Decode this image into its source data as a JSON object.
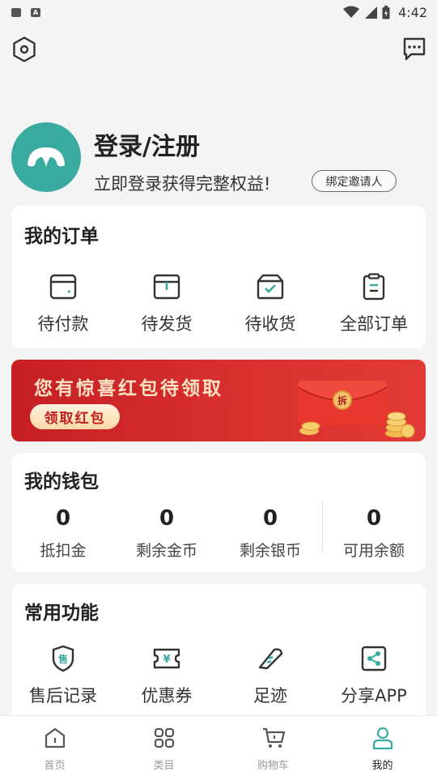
{
  "status_bar": {
    "time": "4:42"
  },
  "profile": {
    "title": "登录/注册",
    "subtitle": "立即登录获得完整权益!",
    "invite_label": "绑定邀请人"
  },
  "orders": {
    "title": "我的订单",
    "items": [
      {
        "label": "待付款",
        "icon": "wallet-card-icon"
      },
      {
        "label": "待发货",
        "icon": "box-icon"
      },
      {
        "label": "待收货",
        "icon": "delivery-check-icon"
      },
      {
        "label": "全部订单",
        "icon": "clipboard-icon"
      }
    ]
  },
  "banner": {
    "title": "您有惊喜红包待领取",
    "button_label": "领取红包",
    "envelope_char": "拆",
    "colors": {
      "bg": "#d12a2a",
      "text": "#fde3c4"
    }
  },
  "wallet": {
    "title": "我的钱包",
    "items": [
      {
        "value": "0",
        "label": "抵扣金"
      },
      {
        "value": "0",
        "label": "剩余金币"
      },
      {
        "value": "0",
        "label": "剩余银币"
      },
      {
        "value": "0",
        "label": "可用余额"
      }
    ]
  },
  "functions": {
    "title": "常用功能",
    "items": [
      {
        "label": "售后记录",
        "icon": "after-sale-shield-icon",
        "glyph": "售"
      },
      {
        "label": "优惠券",
        "icon": "coupon-icon",
        "glyph": "¥"
      },
      {
        "label": "足迹",
        "icon": "footprint-icon"
      },
      {
        "label": "分享APP",
        "icon": "share-icon"
      }
    ]
  },
  "nav": {
    "items": [
      {
        "label": "首页",
        "icon": "home-icon"
      },
      {
        "label": "类目",
        "icon": "grid-icon"
      },
      {
        "label": "购物车",
        "icon": "cart-icon"
      },
      {
        "label": "我的",
        "icon": "user-icon"
      }
    ],
    "active": "我的"
  },
  "colors": {
    "accent": "#3aaba0",
    "page_bg": "#f4f4f4"
  }
}
